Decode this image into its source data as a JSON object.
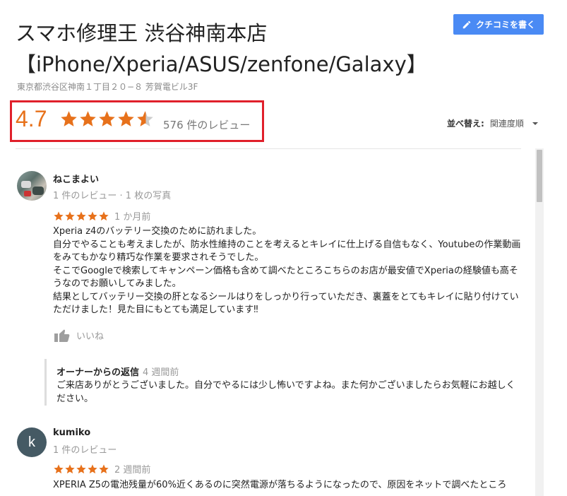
{
  "header": {
    "title": "スマホ修理王 渋谷神南本店",
    "subtitle": "【iPhone/Xperia/ASUS/zenfone/Galaxy】",
    "address": "東京都渋谷区神南１丁目２０−８ 芳賀電ビル3F",
    "write_review_label": "クチコミを書く",
    "write_review_icon": "pencil-icon"
  },
  "summary": {
    "rating": "4.7",
    "rating_value": 4.7,
    "stars_max": 5,
    "review_count_text": "576 件のレビュー",
    "sort_label": "並べ替え:",
    "sort_value": "関連度順",
    "accent_color": "#e7711b",
    "highlight_color": "#e0202b"
  },
  "reviews": [
    {
      "name": "ねこまよい",
      "meta": "1 件のレビュー · 1 枚の写真",
      "stars": 5,
      "time": "1 か月前",
      "text": "Xperia z4のバッテリー交換のために訪れました。\n自分でやることも考えましたが、防水性維持のことを考えるとキレイに仕上げる自信もなく、Youtubeの作業動画をみてもかなり精巧な作業を要求されそうでした。\nそこでGoogleで検索してキャンペーン価格も含めて調べたところこちらのお店が最安値でXperiaの経験値も高そうなのでお願いしてみました。\n結果としてバッテリー交換の肝となるシールはりをしっかり行っていただき、裏蓋をとてもキレイに貼り付けていただけました！見た目にもとても満足しています‼",
      "like_label": "いいね",
      "owner_reply": {
        "title": "オーナーからの返信",
        "time": "4 週間前",
        "text": "ご来店ありがとうございました。自分でやるには少し怖いですよね。また何かございましたらお気軽にお越しください。"
      }
    },
    {
      "name": "kumiko",
      "avatar_letter": "k",
      "meta": "1 件のレビュー",
      "stars": 5,
      "time": "2 週間前",
      "text": "XPERIA Z5の電池残量が60%近くあるのに突然電源が落ちるようになったので、原因をネットで調べたところ"
    }
  ]
}
